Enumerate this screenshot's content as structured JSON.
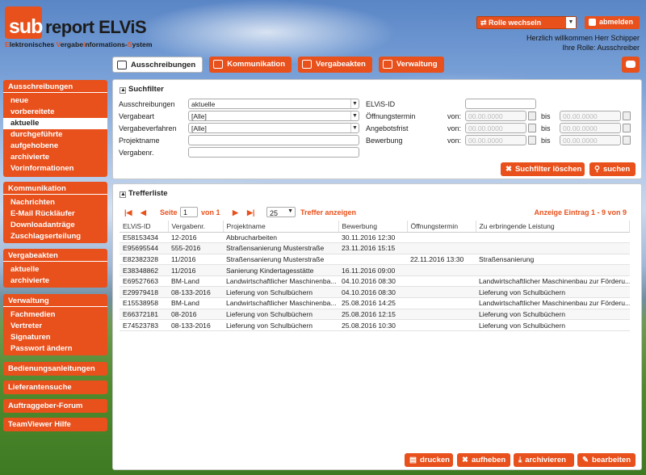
{
  "logo": {
    "sub": "sub",
    "rest": "report ELViS",
    "tag_parts": [
      "E",
      "lektronisches ",
      "V",
      "ergabe",
      "I",
      "nformations-",
      "S",
      "ystem"
    ]
  },
  "header": {
    "role_select": "Rolle wechseln",
    "logout": "abmelden",
    "welcome": "Herzlich willkommen Herr Schipper",
    "role": "Ihre Rolle: Ausschreiber"
  },
  "topnav": [
    "Ausschreibungen",
    "Kommunikation",
    "Vergabeakten",
    "Verwaltung"
  ],
  "sidebar": {
    "ausschreibungen": {
      "title": "Ausschreibungen",
      "items": [
        "neue",
        "vorbereitete",
        "aktuelle",
        "durchgeführte",
        "aufgehobene",
        "archivierte",
        "Vorinformationen"
      ]
    },
    "kommunikation": {
      "title": "Kommunikation",
      "items": [
        "Nachrichten",
        "E-Mail Rückläufer",
        "Downloadanträge",
        "Zuschlagserteilung"
      ]
    },
    "vergabeakten": {
      "title": "Vergabeakten",
      "items": [
        "aktuelle",
        "archivierte"
      ]
    },
    "verwaltung": {
      "title": "Verwaltung",
      "items": [
        "Fachmedien",
        "Vertreter",
        "Signaturen",
        "Passwort ändern"
      ]
    },
    "links": [
      "Bedienungsanleitungen",
      "Lieferantensuche",
      "Auftraggeber-Forum",
      "TeamViewer Hilfe"
    ]
  },
  "search": {
    "title": "Suchfilter",
    "labels": {
      "ausschreibungen": "Ausschreibungen",
      "vergabeart": "Vergabeart",
      "vergabeverfahren": "Vergabeverfahren",
      "projektname": "Projektname",
      "vergabenr": "Vergabenr.",
      "elvis_id": "ELViS-ID",
      "oeffnungstermin": "Öffnungstermin",
      "angebotsfrist": "Angebotsfrist",
      "bewerbung": "Bewerbung",
      "von": "von:",
      "bis": "bis"
    },
    "values": {
      "ausschreibungen": "aktuelle",
      "vergabeart": "[Alle]",
      "vergabeverfahren": "[Alle]"
    },
    "date_placeholder": "00.00.0000",
    "clear_button": "Suchfilter löschen",
    "search_button": "suchen"
  },
  "results": {
    "title": "Trefferliste",
    "pager": {
      "seite": "Seite",
      "page": "1",
      "of": "von 1",
      "per_page": "25",
      "show": "Treffer anzeigen",
      "summary": "Anzeige Eintrag 1 - 9 von 9"
    },
    "columns": [
      "ELViS-ID",
      "Vergabenr.",
      "Projektname",
      "Bewerbung",
      "Öffnungstermin",
      "Zu erbringende Leistung"
    ],
    "rows": [
      [
        "E58153434",
        "12-2016",
        "Abbrucharbeiten",
        "30.11.2016 12:30",
        "",
        ""
      ],
      [
        "E95695544",
        "555-2016",
        "Straßensanierung Musterstraße",
        "23.11.2016 15:15",
        "",
        ""
      ],
      [
        "E82382328",
        "11/2016",
        "Straßensanierung Musterstraße",
        "",
        "22.11.2016 13:30",
        "Straßensanierung"
      ],
      [
        "E38348862",
        "11/2016",
        "Sanierung Kindertagesstätte",
        "16.11.2016 09:00",
        "",
        ""
      ],
      [
        "E69527663",
        "BM-Land",
        "Landwirtschaftlicher Maschinenba...",
        "04.10.2016 08:30",
        "",
        "Landwirtschaftlicher Maschinenbau zur Förderu..."
      ],
      [
        "E29979418",
        "08-133-2016",
        "Lieferung von Schulbüchern",
        "04.10.2016 08:30",
        "",
        "Lieferung von Schulbüchern"
      ],
      [
        "E15538958",
        "BM-Land",
        "Landwirtschaftlicher Maschinenba...",
        "25.08.2016 14:25",
        "",
        "Landwirtschaftlicher Maschinenbau zur Förderu..."
      ],
      [
        "E66372181",
        "08-2016",
        "Lieferung von Schulbüchern",
        "25.08.2016 12:15",
        "",
        "Lieferung von Schulbüchern"
      ],
      [
        "E74523783",
        "08-133-2016",
        "Lieferung von Schulbüchern",
        "25.08.2016 10:30",
        "",
        "Lieferung von Schulbüchern"
      ]
    ],
    "actions": [
      "drucken",
      "aufheben",
      "archivieren",
      "bearbeiten"
    ]
  }
}
